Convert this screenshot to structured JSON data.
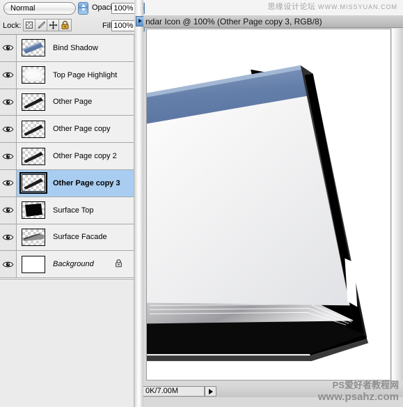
{
  "panel": {
    "blend_mode": "Normal",
    "opacity_label": "Opacity:",
    "opacity_value": "100%",
    "lock_label": "Lock:",
    "fill_label": "Fill:",
    "fill_value": "100%",
    "lock_buttons": [
      {
        "name": "lock-transparent-pixels",
        "icon": "checkerboard-icon"
      },
      {
        "name": "lock-image-pixels",
        "icon": "brush-icon"
      },
      {
        "name": "lock-position",
        "icon": "move-icon"
      },
      {
        "name": "lock-all",
        "icon": "padlock-icon"
      }
    ],
    "layers": [
      {
        "name": "Bind Shadow",
        "visible": true,
        "selected": false,
        "locked": false,
        "italic": false,
        "thumb": "blue-diagonal-bar"
      },
      {
        "name": "Top Page Highlight",
        "visible": true,
        "selected": false,
        "locked": false,
        "italic": false,
        "thumb": "white-soft-blob"
      },
      {
        "name": "Other Page",
        "visible": true,
        "selected": false,
        "locked": false,
        "italic": false,
        "thumb": "thin-dark-diagonal"
      },
      {
        "name": "Other Page copy",
        "visible": true,
        "selected": false,
        "locked": false,
        "italic": false,
        "thumb": "thin-dark-diagonal"
      },
      {
        "name": "Other Page copy 2",
        "visible": true,
        "selected": false,
        "locked": false,
        "italic": false,
        "thumb": "thin-dark-diagonal"
      },
      {
        "name": "Other Page copy 3",
        "visible": true,
        "selected": true,
        "locked": false,
        "italic": false,
        "thumb": "thin-dark-diagonal"
      },
      {
        "name": "Surface Top",
        "visible": true,
        "selected": false,
        "locked": false,
        "italic": false,
        "thumb": "black-quad"
      },
      {
        "name": "Surface Facade",
        "visible": true,
        "selected": false,
        "locked": false,
        "italic": false,
        "thumb": "gray-wedge"
      },
      {
        "name": "Background",
        "visible": true,
        "selected": false,
        "locked": true,
        "italic": true,
        "thumb": "solid-white"
      }
    ]
  },
  "document": {
    "title": "ndar Icon @ 100% (Other Page copy 3, RGB/8)",
    "status_text": "0K/7.00M"
  },
  "watermarks": {
    "top_cn": "思缘设计论坛",
    "top_en": "WWW.MISSYUAN.COM",
    "bottom_line1": "PS爱好者教程网",
    "bottom_line2": "www.psahz.com"
  },
  "colors": {
    "selection_blue": "#a8cdf0",
    "binder_blue": "#5f7cab",
    "panel_bg": "#ebebeb"
  }
}
